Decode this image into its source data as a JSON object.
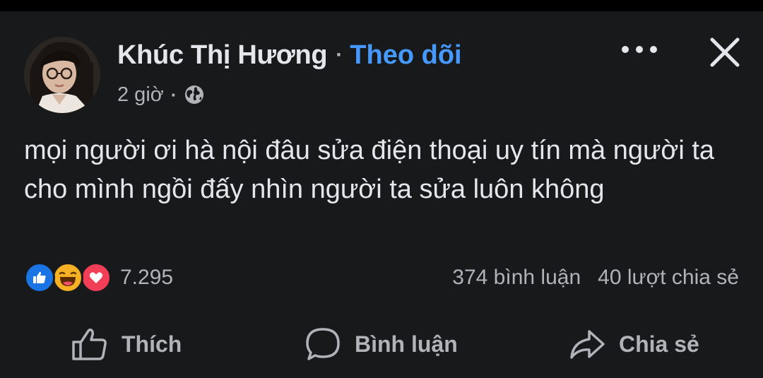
{
  "post": {
    "author": "Khúc Thị Hương",
    "separator": "·",
    "follow_label": "Theo dõi",
    "time": "2 giờ",
    "meta_separator": "·",
    "privacy_icon": "globe-icon",
    "text": "mọi người ơi hà nội đâu sửa điện thoại uy tín mà người ta cho mình ngồi đấy nhìn người ta sửa luôn không"
  },
  "reactions": {
    "icons": [
      "like-reaction-icon",
      "haha-reaction-icon",
      "love-reaction-icon"
    ],
    "count": "7.295",
    "comments": "374 bình luận",
    "shares": "40 lượt chia sẻ"
  },
  "actions": {
    "like_label": "Thích",
    "comment_label": "Bình luận",
    "share_label": "Chia sẻ"
  },
  "colors": {
    "background": "#18191a",
    "text_primary": "#e4e6eb",
    "text_secondary": "#b0b3b8",
    "follow_blue": "#4599ff",
    "like_blue": "#1b74e4",
    "haha_yellow": "#f7b125",
    "love_red": "#f33e58"
  }
}
